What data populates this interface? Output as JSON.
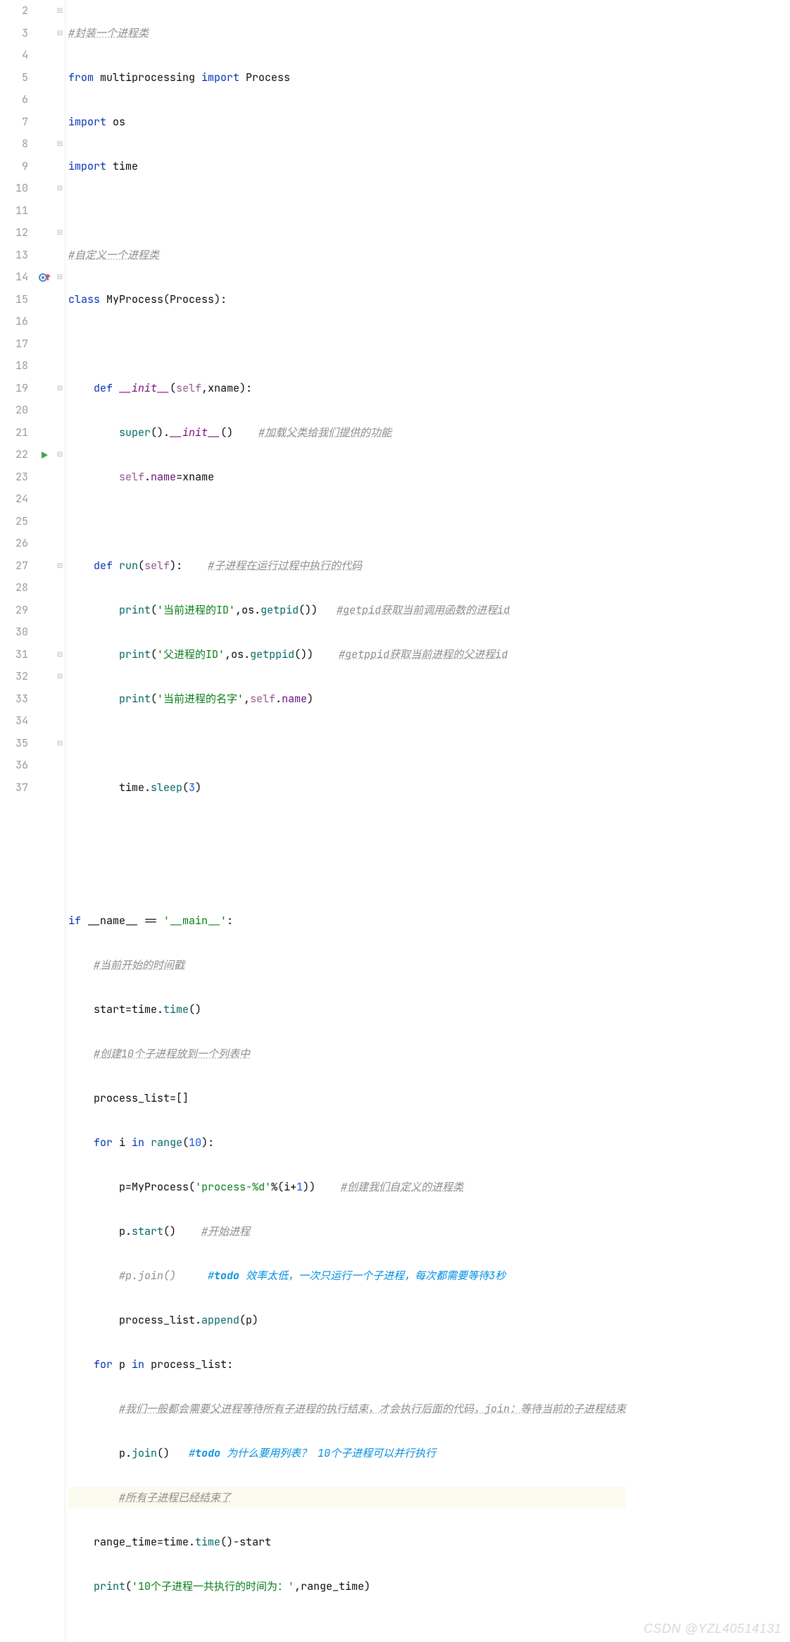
{
  "watermark": "CSDN @YZL40514131",
  "lines": {
    "l2": {
      "num": "2",
      "fold": "⊟",
      "c1": "#封装一个进程类"
    },
    "l3": {
      "num": "3",
      "fold": "⊟",
      "k1": "from ",
      "id1": "multiprocessing ",
      "k2": "import ",
      "id2": "Process"
    },
    "l4": {
      "num": "4",
      "fold": "",
      "k1": "import ",
      "id1": "os"
    },
    "l5": {
      "num": "5",
      "fold": "",
      "k1": "import ",
      "id1": "time"
    },
    "l6": {
      "num": "6",
      "fold": ""
    },
    "l7": {
      "num": "7",
      "fold": "",
      "c1": "#自定义一个进程类"
    },
    "l8": {
      "num": "8",
      "fold": "⊟",
      "k1": "class ",
      "id1": "MyProcess",
      "p1": "(",
      "id2": "Process",
      "p2": "):"
    },
    "l9": {
      "num": "9",
      "fold": ""
    },
    "l10": {
      "num": "10",
      "fold": "⊟",
      "k1": "def ",
      "fn": "__init__",
      "p1": "(",
      "self": "self",
      "c": ",",
      "id1": "xname",
      "p2": "):"
    },
    "l11": {
      "num": "11",
      "fold": "",
      "fn1": "super",
      "p1": "().",
      "fn2": "__init__",
      "p2": "()    ",
      "c1": "#加载父类给我们提供的功能"
    },
    "l12": {
      "num": "12",
      "fold": "⊟",
      "self": "self",
      "d": ".",
      "attr": "name",
      "eq": "=",
      "id": "xname"
    },
    "l13": {
      "num": "13",
      "fold": ""
    },
    "l14": {
      "num": "14",
      "fold": "⊟",
      "k1": "def ",
      "fn": "run",
      "p1": "(",
      "self": "self",
      "p2": "):    ",
      "c1": "#子进程在运行过程中执行的代码"
    },
    "l15": {
      "num": "15",
      "fold": "",
      "fn": "print",
      "p1": "(",
      "s": "'当前进程的ID'",
      "c": ",",
      "id": "os.",
      "fn2": "getpid",
      "p2": "())   ",
      "cmt": "#getpid获取当前调用函数的进程id"
    },
    "l16": {
      "num": "16",
      "fold": "",
      "fn": "print",
      "p1": "(",
      "s": "'父进程的ID'",
      "c": ",",
      "id": "os.",
      "fn2": "getppid",
      "p2": "())    ",
      "cmt": "#getppid获取当前进程的父进程id"
    },
    "l17": {
      "num": "17",
      "fold": "",
      "fn": "print",
      "p1": "(",
      "s": "'当前进程的名字'",
      "c": ",",
      "self": "self",
      "d": ".",
      "attr": "name",
      "p2": ")"
    },
    "l18": {
      "num": "18",
      "fold": ""
    },
    "l19": {
      "num": "19",
      "fold": "⊟",
      "id": "time.",
      "fn": "sleep",
      "p1": "(",
      "n": "3",
      "p2": ")"
    },
    "l20": {
      "num": "20",
      "fold": ""
    },
    "l21": {
      "num": "21",
      "fold": ""
    },
    "l22": {
      "num": "22",
      "fold": "⊟",
      "k": "if ",
      "id": "__name__ == ",
      "s": "'__main__'",
      "p": ":"
    },
    "l23": {
      "num": "23",
      "fold": "",
      "cmt": "#当前开始的时间戳"
    },
    "l24": {
      "num": "24",
      "fold": "",
      "id": "start=time.",
      "fn": "time",
      "p": "()"
    },
    "l25": {
      "num": "25",
      "fold": "",
      "cmt": "#创建10个子进程放到一个列表中"
    },
    "l26": {
      "num": "26",
      "fold": "",
      "id": "process_list=[]"
    },
    "l27": {
      "num": "27",
      "fold": "⊟",
      "k": "for ",
      "id1": "i ",
      "k2": "in ",
      "fn": "range",
      "p1": "(",
      "n": "10",
      "p2": "):"
    },
    "l28": {
      "num": "28",
      "fold": "",
      "id1": "p=",
      "cl": "MyProcess",
      "p1": "(",
      "s": "'process-%d'",
      "op": "%(",
      "id2": "i+",
      "n": "1",
      "p2": "))    ",
      "cmt": "#创建我们自定义的进程类"
    },
    "l29": {
      "num": "29",
      "fold": "",
      "id": "p.",
      "fn": "start",
      "p": "()    ",
      "cmt": "#开始进程"
    },
    "l30": {
      "num": "30",
      "fold": "",
      "cmt1": "#p.join()     ",
      "cmt2": "#",
      "todo": "todo",
      "cmt3": " 效率太低，一次只运行一个子进程，每次都需要等待3秒"
    },
    "l31": {
      "num": "31",
      "fold": "⊟",
      "id": "process_list.",
      "fn": "append",
      "p": "(p)"
    },
    "l32": {
      "num": "32",
      "fold": "⊟",
      "k": "for ",
      "id1": "p ",
      "k2": "in ",
      "id2": "process_list:"
    },
    "l33": {
      "num": "33",
      "fold": "",
      "cmt": "#我们一般都会需要父进程等待所有子进程的执行结束，才会执行后面的代码，join：等待当前的子进程结束"
    },
    "l34": {
      "num": "34",
      "fold": "",
      "id": "p.",
      "fn": "join",
      "p": "()   ",
      "cmt1": "#",
      "todo": "todo",
      "cmt2": " 为什么要用列表？ 10个子进程可以并行执行"
    },
    "l35": {
      "num": "35",
      "fold": "⊟",
      "cmt": "#所有子进程已经结束了"
    },
    "l36": {
      "num": "36",
      "fold": "",
      "id1": "range_time=time.",
      "fn": "time",
      "p": "()-",
      "id2": "start"
    },
    "l37": {
      "num": "37",
      "fold": "",
      "fn": "print",
      "p1": "(",
      "s": "'10个子进程一共执行的时间为：'",
      "c": ",",
      "id": "range_time",
      "p2": ")"
    }
  }
}
